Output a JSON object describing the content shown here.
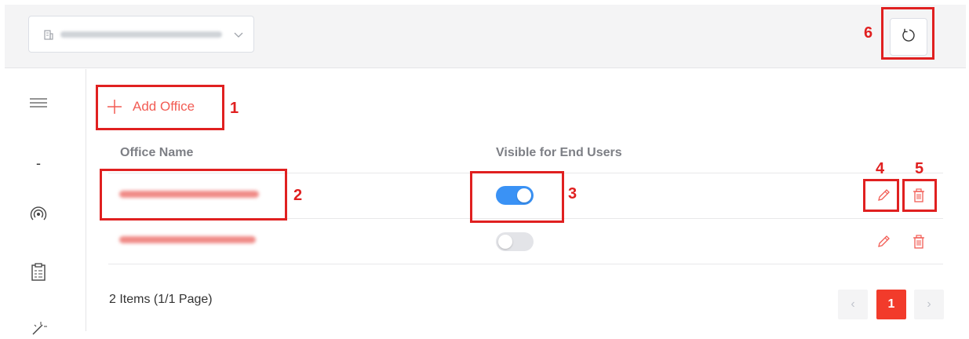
{
  "header": {
    "site_icon": "building-icon",
    "site_dropdown_icon": "chevron-down-icon",
    "refresh_icon": "refresh-icon"
  },
  "sidebar": {
    "items": [
      {
        "icon": "menu-icon"
      },
      {
        "label": "-"
      },
      {
        "icon": "broadcast-icon"
      },
      {
        "icon": "clipboard-icon"
      },
      {
        "icon": "wand-icon"
      }
    ]
  },
  "toolbar": {
    "add_label": "Add Office"
  },
  "table": {
    "columns": [
      "Office Name",
      "Visible for End Users"
    ],
    "rows": [
      {
        "visible": true,
        "edit_icon": "pencil-icon",
        "delete_icon": "trash-icon"
      },
      {
        "visible": false,
        "edit_icon": "pencil-icon",
        "delete_icon": "trash-icon"
      }
    ]
  },
  "footer": {
    "count_text": "2 Items (1/1 Page)",
    "prev": "‹",
    "current_page": "1",
    "next": "›"
  },
  "annotations": [
    "1",
    "2",
    "3",
    "4",
    "5",
    "6"
  ],
  "colors": {
    "accent": "#f25c54",
    "toggle_on": "#3a92f5",
    "annotation": "#e02020",
    "page_active": "#f23b2b"
  }
}
